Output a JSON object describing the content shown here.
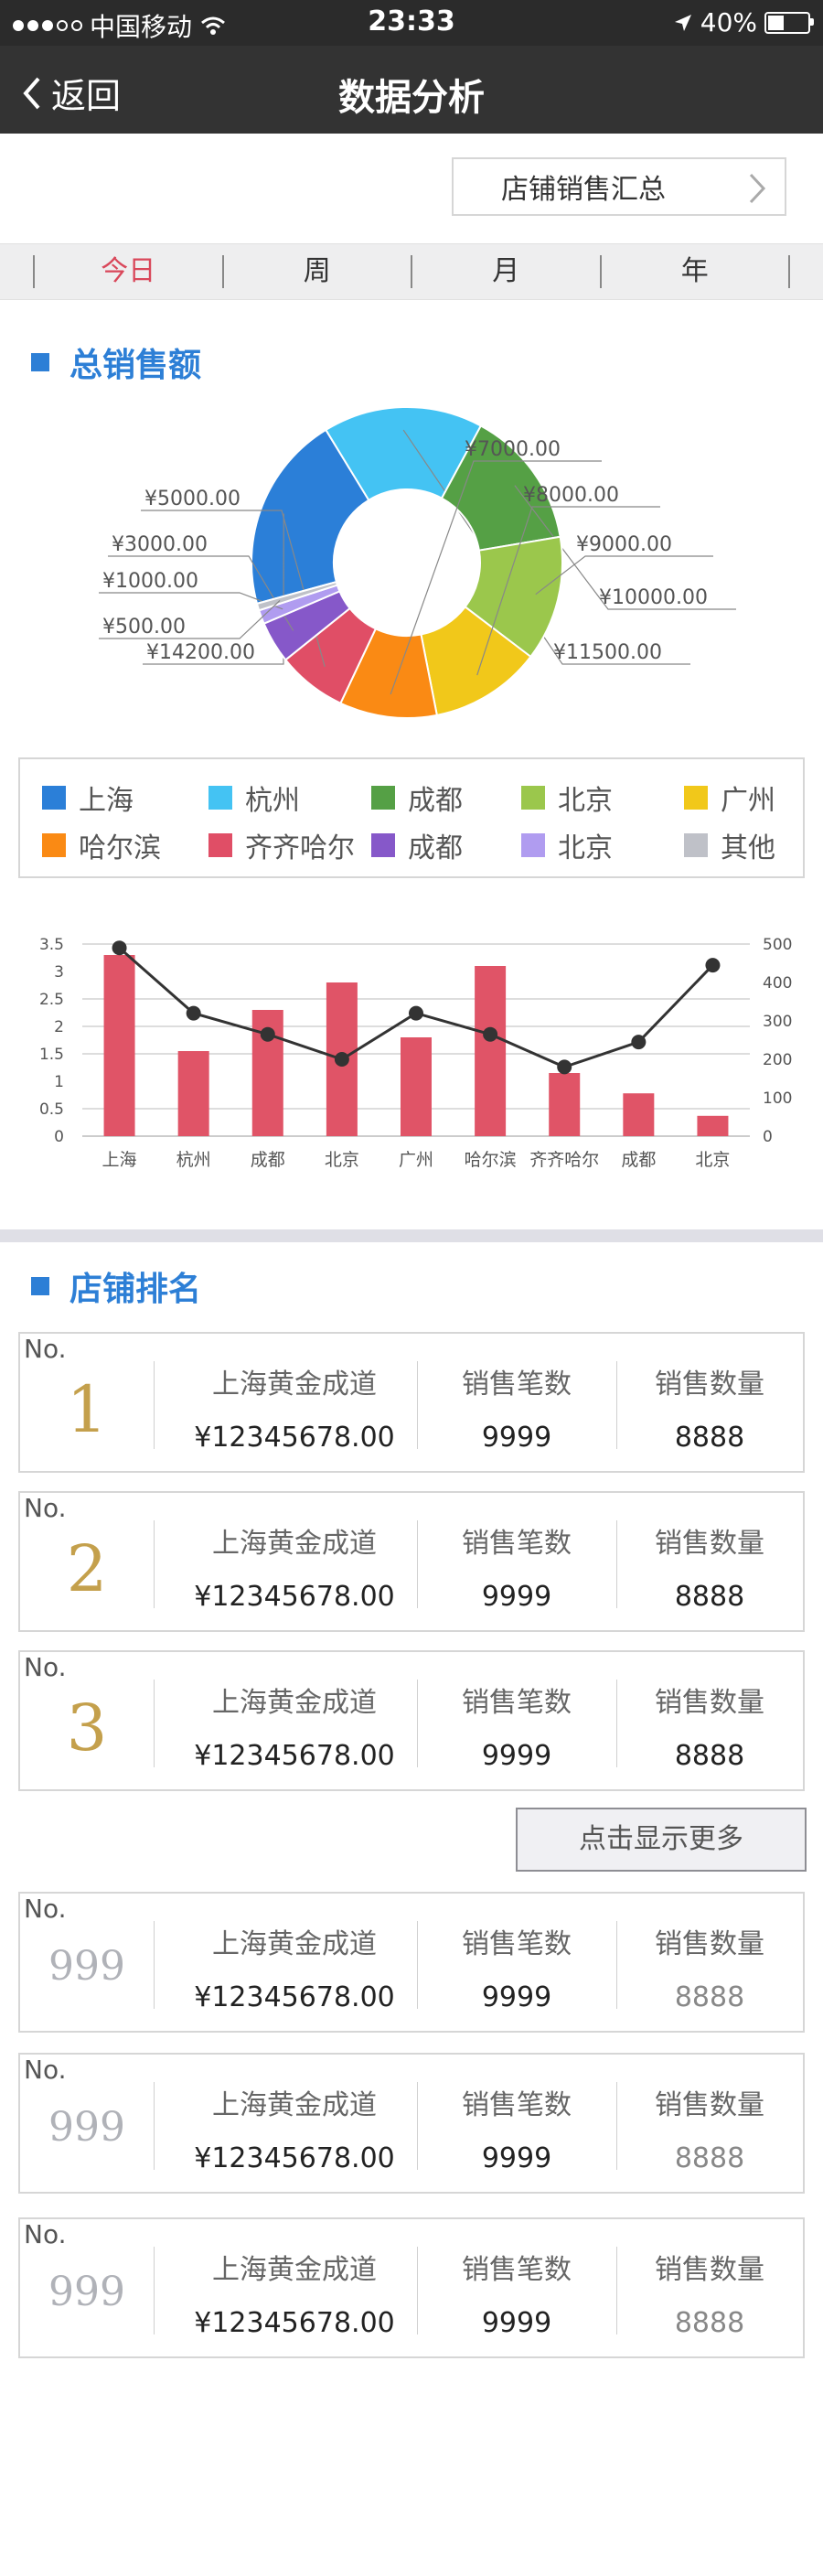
{
  "status_bar": {
    "carrier": "中国移动",
    "time": "23:33",
    "battery": "40%"
  },
  "nav": {
    "back_label": "返回",
    "title": "数据分析"
  },
  "store_selector": {
    "label": "店铺销售汇总"
  },
  "tabs": [
    "今日",
    "周",
    "月",
    "年"
  ],
  "active_tab": 0,
  "sales_section": {
    "title": "总销售额"
  },
  "colors": {
    "accent_blue": "#2d7fd6",
    "active_tab": "#d9475a",
    "bar": "#e05467",
    "gold": "#c4a04c"
  },
  "chart_data": [
    {
      "type": "pie",
      "donut": true,
      "slices": [
        {
          "label": "¥14200.00",
          "value": 14200,
          "color": "#2b7fd8"
        },
        {
          "label": "¥11500.00",
          "value": 11500,
          "color": "#44c3f3"
        },
        {
          "label": "¥10000.00",
          "value": 10000,
          "color": "#55a045"
        },
        {
          "label": "¥9000.00",
          "value": 9000,
          "color": "#9bc74c"
        },
        {
          "label": "¥8000.00",
          "value": 8000,
          "color": "#f1c81a"
        },
        {
          "label": "¥7000.00",
          "value": 7000,
          "color": "#fa8a14"
        },
        {
          "label": "¥5000.00",
          "value": 5000,
          "color": "#e04e66"
        },
        {
          "label": "¥3000.00",
          "value": 3000,
          "color": "#8658c9"
        },
        {
          "label": "¥1000.00",
          "value": 1000,
          "color": "#b09cf0"
        },
        {
          "label": "¥500.00",
          "value": 500,
          "color": "#bfc1c8"
        }
      ],
      "legend": [
        {
          "name": "上海",
          "color": "#2b7fd8"
        },
        {
          "name": "杭州",
          "color": "#44c3f3"
        },
        {
          "name": "成都",
          "color": "#55a045"
        },
        {
          "name": "北京",
          "color": "#9bc74c"
        },
        {
          "name": "广州",
          "color": "#f1c81a"
        },
        {
          "name": "哈尔滨",
          "color": "#fa8a14"
        },
        {
          "name": "齐齐哈尔",
          "color": "#e04e66"
        },
        {
          "name": "成都",
          "color": "#8658c9"
        },
        {
          "name": "北京",
          "color": "#b09cf0"
        },
        {
          "name": "其他",
          "color": "#bfc1c8"
        }
      ]
    },
    {
      "type": "bar",
      "categories": [
        "上海",
        "杭州",
        "成都",
        "北京",
        "广州",
        "哈尔滨",
        "齐齐哈尔",
        "成都",
        "北京"
      ],
      "series": [
        {
          "values": [
            3.3,
            1.55,
            2.3,
            2.8,
            1.8,
            3.1,
            1.15,
            0.78,
            0.37
          ],
          "color": "#e05467",
          "axis": "left"
        },
        {
          "type": "line",
          "values": [
            490,
            320,
            265,
            200,
            320,
            265,
            180,
            245,
            445
          ],
          "color": "#333333",
          "axis": "right"
        }
      ],
      "ylim_left": [
        0,
        3.5
      ],
      "yticks_left": [
        "0",
        "0.5",
        "1",
        "1.5",
        "2",
        "2.5",
        "3",
        "3.5"
      ],
      "ylim_right": [
        0,
        500
      ],
      "yticks_right": [
        "0",
        "100",
        "200",
        "300",
        "400",
        "500"
      ]
    }
  ],
  "ranking_section": {
    "title": "店铺排名"
  },
  "ranking": [
    {
      "no_label": "No.",
      "rank": "1",
      "store": "上海黄金成道",
      "amount": "¥12345678.00",
      "count_label": "销售笔数",
      "count": "9999",
      "qty_label": "销售数量",
      "qty": "8888",
      "style": "gold"
    },
    {
      "no_label": "No.",
      "rank": "2",
      "store": "上海黄金成道",
      "amount": "¥12345678.00",
      "count_label": "销售笔数",
      "count": "9999",
      "qty_label": "销售数量",
      "qty": "8888",
      "style": "gold"
    },
    {
      "no_label": "No.",
      "rank": "3",
      "store": "上海黄金成道",
      "amount": "¥12345678.00",
      "count_label": "销售笔数",
      "count": "9999",
      "qty_label": "销售数量",
      "qty": "8888",
      "style": "gold"
    },
    {
      "no_label": "No.",
      "rank": "999",
      "store": "上海黄金成道",
      "amount": "¥12345678.00",
      "count_label": "销售笔数",
      "count": "9999",
      "qty_label": "销售数量",
      "qty": "8888",
      "style": "gray"
    },
    {
      "no_label": "No.",
      "rank": "999",
      "store": "上海黄金成道",
      "amount": "¥12345678.00",
      "count_label": "销售笔数",
      "count": "9999",
      "qty_label": "销售数量",
      "qty": "8888",
      "style": "gray"
    },
    {
      "no_label": "No.",
      "rank": "999",
      "store": "上海黄金成道",
      "amount": "¥12345678.00",
      "count_label": "销售笔数",
      "count": "9999",
      "qty_label": "销售数量",
      "qty": "8888",
      "style": "gray"
    }
  ],
  "more_button": {
    "label": "点击显示更多"
  }
}
